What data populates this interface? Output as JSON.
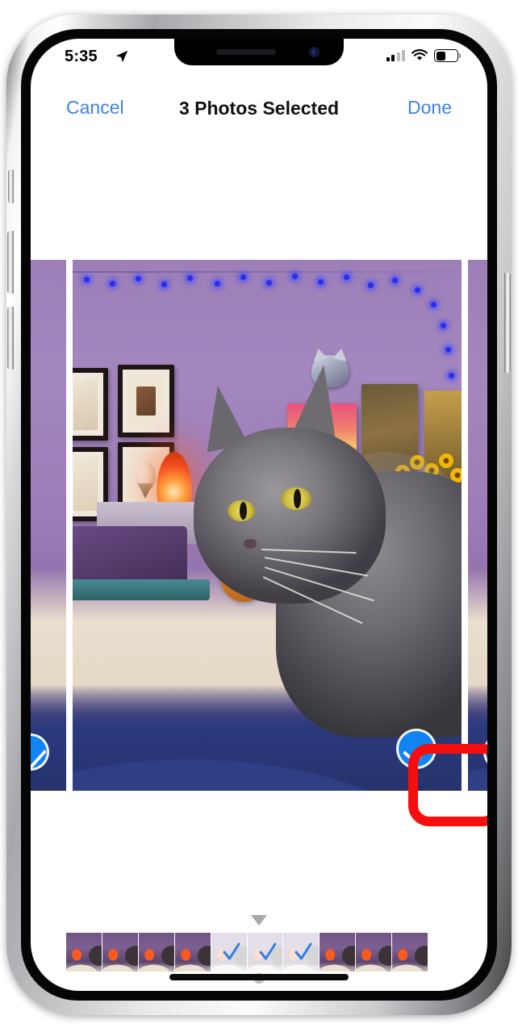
{
  "device": {
    "name": "iphone-x-silver"
  },
  "status_bar": {
    "time": "5:35",
    "location_icon": "location-arrow-icon",
    "cellular_icon": "cellular-signal-icon",
    "cellular_bars_filled": 2,
    "cellular_bars_total": 4,
    "wifi_icon": "wifi-icon",
    "battery_icon": "battery-icon",
    "battery_percent": 50
  },
  "nav_bar": {
    "cancel_label": "Cancel",
    "title": "3 Photos Selected",
    "done_label": "Done",
    "tint_color": "#3f82e8"
  },
  "carousel": {
    "selected_count": 3,
    "photos": [
      {
        "position": "previous",
        "alt": "grey cat in purple room",
        "selected": true
      },
      {
        "position": "current",
        "alt": "grey long-haired cat on cream blanket in purple room with string lights, framed art, DOORS poster and sunflowers",
        "selected": true
      },
      {
        "position": "next",
        "alt": "grey cat in purple room",
        "selected": true
      }
    ],
    "selection_badge_icon": "check-circle-icon",
    "selection_badge_color": "#1184f3"
  },
  "annotation": {
    "shape": "rounded-rectangle-outline",
    "color": "#f60d0d",
    "target": "selection-check-badge"
  },
  "filmstrip": {
    "pointer_icon": "triangle-down-icon",
    "page_dot_icon": "page-dot-icon",
    "thumbnails": [
      {
        "index": 0,
        "selected": false
      },
      {
        "index": 1,
        "selected": false
      },
      {
        "index": 2,
        "selected": false
      },
      {
        "index": 3,
        "selected": false
      },
      {
        "index": 4,
        "selected": true,
        "check_icon": "check-icon"
      },
      {
        "index": 5,
        "selected": true,
        "check_icon": "check-icon"
      },
      {
        "index": 6,
        "selected": true,
        "check_icon": "check-icon"
      },
      {
        "index": 7,
        "selected": false
      },
      {
        "index": 8,
        "selected": false
      },
      {
        "index": 9,
        "selected": false
      }
    ],
    "check_color": "#2f7fe0"
  },
  "home_indicator": {
    "name": "home-indicator"
  }
}
